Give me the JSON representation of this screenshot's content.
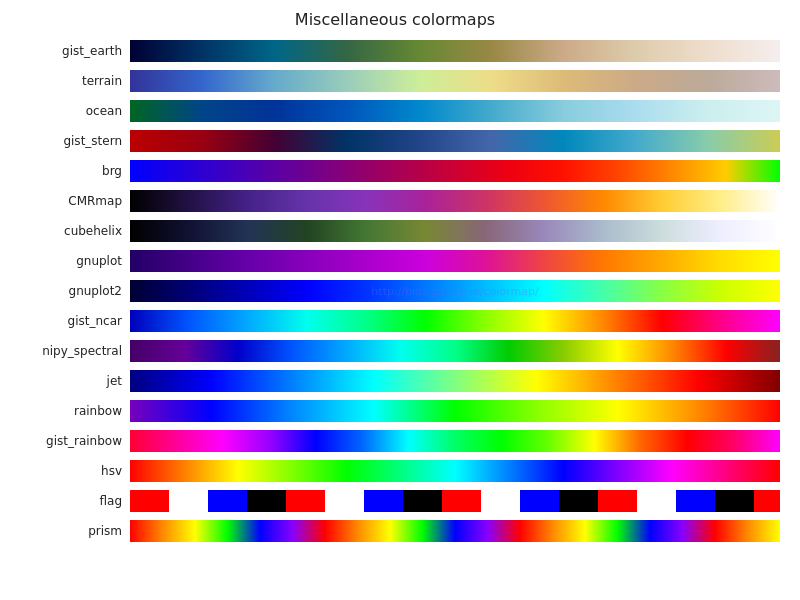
{
  "title": "Miscellaneous colormaps",
  "watermark": "http://bids.github.io/colormap/",
  "colormaps": [
    {
      "name": "gist_earth",
      "gradient": "linear-gradient(to right, #000033, #003366, #006688, #336644, #668833, #998844, #ccaa88, #ddccaa, #eeddcc, #f5eeee)"
    },
    {
      "name": "terrain",
      "gradient": "linear-gradient(to right, #333399, #3366cc, #66aacc, #99ccbb, #ccee99, #eedd88, #ddbb77, #ccaa88, #bbaa99, #ccbbbb)"
    },
    {
      "name": "ocean",
      "gradient": "linear-gradient(to right, #006622, #004488, #003399, #0055bb, #0088cc, #44aacc, #88ccdd, #aaddee, #cceeee, #ddf5f5)"
    },
    {
      "name": "gist_stern",
      "gradient": "linear-gradient(to right, #bb0000, #990011, #440033, #003366, #224488, #4466aa, #0088bb, #44aacc, #88ccaa, #cccc55)"
    },
    {
      "name": "brg",
      "gradient": "linear-gradient(to right, #0000ff, #2200dd, #4400bb, #660099, #880077, #aa0055, #cc0033, #ee0011, #ff1100, #ff4400, #ff8800, #ffcc00, #00ff00)"
    },
    {
      "name": "CMRmap",
      "gradient": "linear-gradient(to right, #000000, #221144, #442288, #6633aa, #8833bb, #aa2299, #cc3366, #ee5533, #ff8800, #ffcc33, #ffee88, #ffffff)"
    },
    {
      "name": "cubehelix",
      "gradient": "linear-gradient(to right, #000000, #111133, #223355, #224422, #447733, #778833, #886677, #9988bb, #aabbcc, #ccdddd, #eeeeff, #ffffff)"
    },
    {
      "name": "gnuplot",
      "gradient": "linear-gradient(to right, #220066, #440088, #6600aa, #8800bb, #aa00cc, #cc00dd, #dd1199, #ee4444, #ff7700, #ffaa00, #ffdd00, #ffff00)"
    },
    {
      "name": "gnuplot2",
      "gradient": "linear-gradient(to right, #000033, #000077, #0000bb, #0000ff, #0033ff, #0077ff, #00bbff, #00ffff, #44ffaa, #88ff44, #ccff00, #ffff00)"
    },
    {
      "name": "gist_ncar",
      "gradient": "linear-gradient(to right, #0000bb, #0055ff, #00aaff, #00ffee, #00ff88, #00ff00, #88ff00, #ffff00, #ff8800, #ff0000, #ff0088, #ff00ff)"
    },
    {
      "name": "nipy_spectral",
      "gradient": "linear-gradient(to right, #440066, #660099, #0000cc, #0055ff, #00aaff, #00ffee, #00ff88, #00cc00, #88cc00, #ffff00, #ff8800, #ff0000, #882222)"
    },
    {
      "name": "jet",
      "gradient": "linear-gradient(to right, #000080, #0000ff, #0080ff, #00ffff, #80ff80, #ffff00, #ff8000, #ff0000, #800000)"
    },
    {
      "name": "rainbow",
      "gradient": "linear-gradient(to right, #7700bb, #0000ff, #0088ff, #00ffff, #00ff00, #88ff00, #ffff00, #ff8800, #ff0000)"
    },
    {
      "name": "gist_rainbow",
      "gradient": "linear-gradient(to right, #ff0033, #ff0099, #ff00ff, #9900ff, #0000ff, #0066ff, #00ffff, #00ff66, #00ff00, #66ff00, #ffff00, #ff6600, #ff0000, #ff0066, #ff00ff)"
    },
    {
      "name": "hsv",
      "gradient": "linear-gradient(to right, #ff0000, #ffff00, #00ff00, #00ffff, #0000ff, #ff00ff, #ff0000)"
    },
    {
      "name": "flag",
      "gradient": "repeating-linear-gradient(to right, #ff0000 0%, #ff0000 6%, #ffffff 6%, #ffffff 12%, #0000ff 12%, #0000ff 18%, #000000 18%, #000000 24%)"
    },
    {
      "name": "prism",
      "gradient": "repeating-linear-gradient(to right, #ff0000 0%, #ff8800 5%, #ffff00 10%, #00ff00 15%, #0000ff 20%, #8800ff 25%, #ff0000 30%)"
    }
  ]
}
